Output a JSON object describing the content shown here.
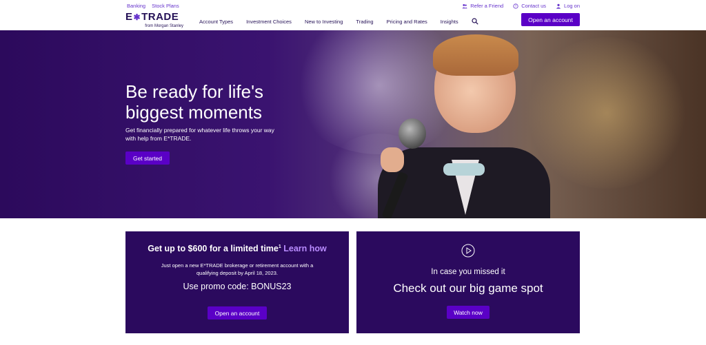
{
  "utility": {
    "links_left": [
      "Banking",
      "Stock Plans"
    ],
    "refer": "Refer a Friend",
    "contact": "Contact us",
    "login": "Log on"
  },
  "brand": {
    "logo_left": "E",
    "logo_right": "TRADE",
    "sub": "from Morgan Stanley"
  },
  "nav": {
    "items": [
      "Account Types",
      "Investment Choices",
      "New to Investing",
      "Trading",
      "Pricing and Rates",
      "Insights"
    ],
    "open_account": "Open an account"
  },
  "hero": {
    "title": "Be ready for life's biggest moments",
    "description": "Get financially prepared for whatever life throws your way with help from E*TRADE.",
    "cta": "Get started"
  },
  "promo": {
    "headline": "Get up to $600 for a limited time",
    "sup": "1",
    "learn": "Learn how",
    "text": "Just open a new E*TRADE brokerage or retirement account with a qualifying deposit by April 18, 2023.",
    "code": "Use promo code: BONUS23",
    "cta": "Open an account"
  },
  "video": {
    "missed": "In case you missed it",
    "title": "Check out our big game spot",
    "cta": "Watch now"
  },
  "colors": {
    "brand_purple": "#5a00c6",
    "dark_purple": "#2b0a5e",
    "link_purple": "#6633cc",
    "learn_link": "#b98cff"
  },
  "icons": [
    "refer-friend-icon",
    "contact-icon",
    "user-icon",
    "search-icon",
    "play-icon",
    "star-icon"
  ]
}
